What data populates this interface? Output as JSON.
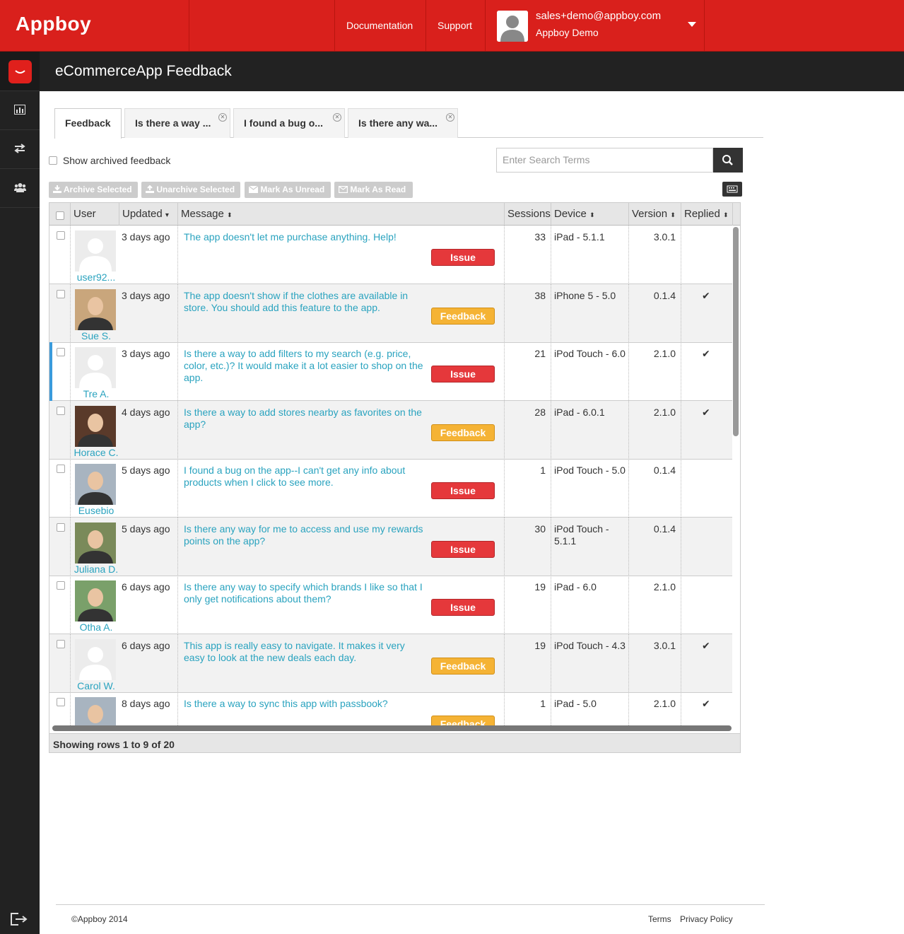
{
  "topbar": {
    "logo": "Appboy",
    "documentation": "Documentation",
    "support": "Support",
    "user_email": "sales+demo@appboy.com",
    "user_name": "Appboy Demo"
  },
  "header": {
    "title": "eCommerceApp Feedback"
  },
  "tabs": [
    {
      "label": "Feedback"
    },
    {
      "label": "Is there a way ..."
    },
    {
      "label": "I found a bug o..."
    },
    {
      "label": "Is there any wa..."
    }
  ],
  "filters": {
    "show_archived": "Show archived feedback",
    "search_placeholder": "Enter Search Terms"
  },
  "actions": {
    "archive": "Archive Selected",
    "unarchive": "Unarchive Selected",
    "mark_unread": "Mark As Unread",
    "mark_read": "Mark As Read"
  },
  "columns": {
    "user": "User",
    "updated": "Updated",
    "message": "Message",
    "sessions": "Sessions",
    "device": "Device",
    "version": "Version",
    "replied": "Replied"
  },
  "rows": [
    {
      "user": "user92...",
      "updated": "3 days ago",
      "message": "The app doesn't let me purchase anything. Help!",
      "tag": "Issue",
      "sessions": "33",
      "device": "iPad - 5.1.1",
      "version": "3.0.1",
      "replied": ""
    },
    {
      "user": "Sue S.",
      "updated": "3 days ago",
      "message": "The app doesn't show if the clothes are available in store. You should add this feature to the app.",
      "tag": "Feedback",
      "sessions": "38",
      "device": "iPhone 5 - 5.0",
      "version": "0.1.4",
      "replied": "✔"
    },
    {
      "user": "Tre A.",
      "updated": "3 days ago",
      "message": "Is there a way to add filters to my search (e.g. price, color, etc.)? It would make it a lot easier to shop on the app.",
      "tag": "Issue",
      "sessions": "21",
      "device": "iPod Touch - 6.0",
      "version": "2.1.0",
      "replied": "✔"
    },
    {
      "user": "Horace C.",
      "updated": "4 days ago",
      "message": "Is there a way to add stores nearby as favorites on the app?",
      "tag": "Feedback",
      "sessions": "28",
      "device": "iPad - 6.0.1",
      "version": "2.1.0",
      "replied": "✔"
    },
    {
      "user": "Eusebio",
      "updated": "5 days ago",
      "message": "I found a bug on the app--I can't get any info about products when I click to see more.",
      "tag": "Issue",
      "sessions": "1",
      "device": "iPod Touch - 5.0",
      "version": "0.1.4",
      "replied": ""
    },
    {
      "user": "Juliana D.",
      "updated": "5 days ago",
      "message": "Is there any way for me to access and use my rewards points on the app?",
      "tag": "Issue",
      "sessions": "30",
      "device": "iPod Touch - 5.1.1",
      "version": "0.1.4",
      "replied": ""
    },
    {
      "user": "Otha A.",
      "updated": "6 days ago",
      "message": "Is there any way to specify which brands I like so that I only get notifications about them?",
      "tag": "Issue",
      "sessions": "19",
      "device": "iPad - 6.0",
      "version": "2.1.0",
      "replied": ""
    },
    {
      "user": "Carol W.",
      "updated": "6 days ago",
      "message": "This app is really easy to navigate. It makes it very easy to look at the new deals each day.",
      "tag": "Feedback",
      "sessions": "19",
      "device": "iPod Touch - 4.3",
      "version": "3.0.1",
      "replied": "✔"
    },
    {
      "user": "",
      "updated": "8 days ago",
      "message": "Is there a way to sync this app with passbook?",
      "tag": "Feedback",
      "sessions": "1",
      "device": "iPad - 5.0",
      "version": "2.1.0",
      "replied": "✔"
    }
  ],
  "grid_footer": "Showing rows 1 to 9 of 20",
  "footer": {
    "copyright": "©Appboy 2014",
    "terms": "Terms",
    "privacy": "Privacy Policy"
  },
  "colors": {
    "brand_red": "#d9201c",
    "link_teal": "#2aa3bf",
    "issue_red": "#e5383b",
    "feedback_orange": "#f5b335"
  }
}
